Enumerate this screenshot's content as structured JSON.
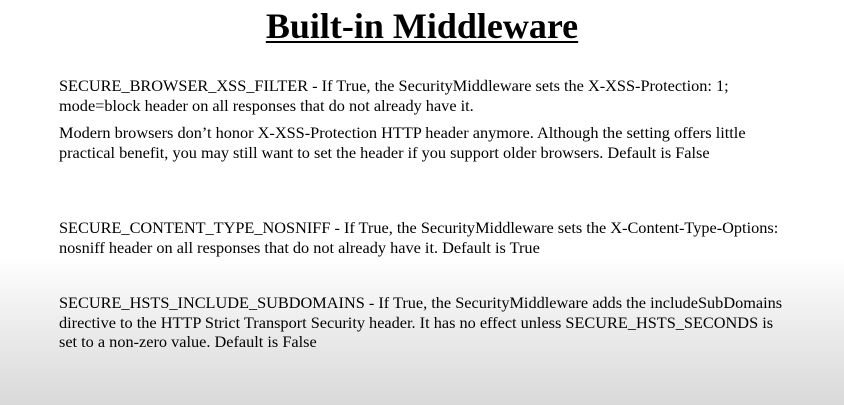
{
  "slide": {
    "title": "Built-in Middleware",
    "paragraphs": [
      "SECURE_BROWSER_XSS_FILTER - If True, the SecurityMiddleware sets the X-XSS-Protection: 1; mode=block header on all responses that do not already have it.",
      "Modern browsers don’t honor X-XSS-Protection HTTP header anymore. Although the setting offers little practical benefit, you may still want to set the header if you support older browsers. Default is False",
      "SECURE_CONTENT_TYPE_NOSNIFF - If True, the SecurityMiddleware sets the X-Content-Type-Options: nosniff header on all responses that do not already have it. Default is True",
      "SECURE_HSTS_INCLUDE_SUBDOMAINS - If True, the SecurityMiddleware adds the includeSubDomains directive to the HTTP Strict Transport Security header. It has no effect unless SECURE_HSTS_SECONDS is set to a non-zero value. Default is False"
    ]
  }
}
